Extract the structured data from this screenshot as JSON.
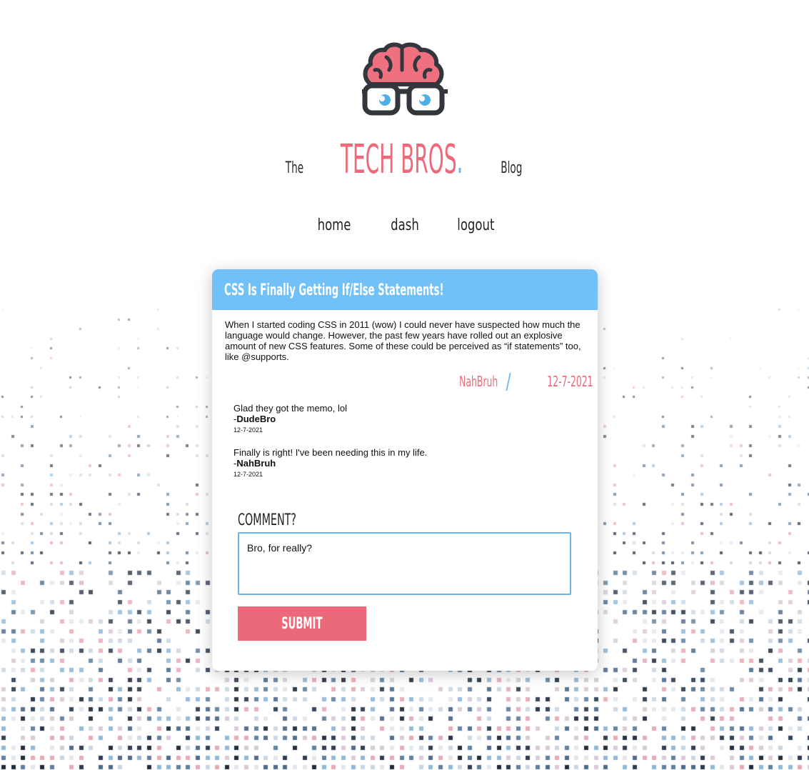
{
  "brand": {
    "title_prefix": "The",
    "title_main": "TECH BROS",
    "title_dot": ".",
    "title_suffix": "Blog",
    "colors": {
      "pink": "#ec6a7a",
      "blue": "#66b8f1",
      "dark": "#2a2a2a"
    }
  },
  "nav": {
    "items": [
      {
        "label": "home"
      },
      {
        "label": "dash"
      },
      {
        "label": "logout"
      }
    ]
  },
  "post": {
    "title": "CSS Is Finally Getting If/Else Statements!",
    "body": "When I started coding CSS in 2011 (wow) I could never have suspected how much the language would change. However, the past few years have rolled out an explosive amount of new CSS features. Some of these could be perceived as “if statements” too, like @supports.",
    "author": "NahBruh",
    "separator": "/",
    "date": "12-7-2021",
    "header_color": "#72c0f8"
  },
  "comments": [
    {
      "text": "Glad they got the memo, lol",
      "prefix": "-",
      "author": "DudeBro",
      "date": "12-7-2021"
    },
    {
      "text": "Finally is right! I've been needing this in my life.",
      "prefix": "-",
      "author": "NahBruh",
      "date": "12-7-2021"
    }
  ],
  "comment_form": {
    "label": "COMMENT?",
    "value": "Bro, for really?",
    "submit_label": "SUBMIT",
    "submit_color": "#eb6a79"
  }
}
